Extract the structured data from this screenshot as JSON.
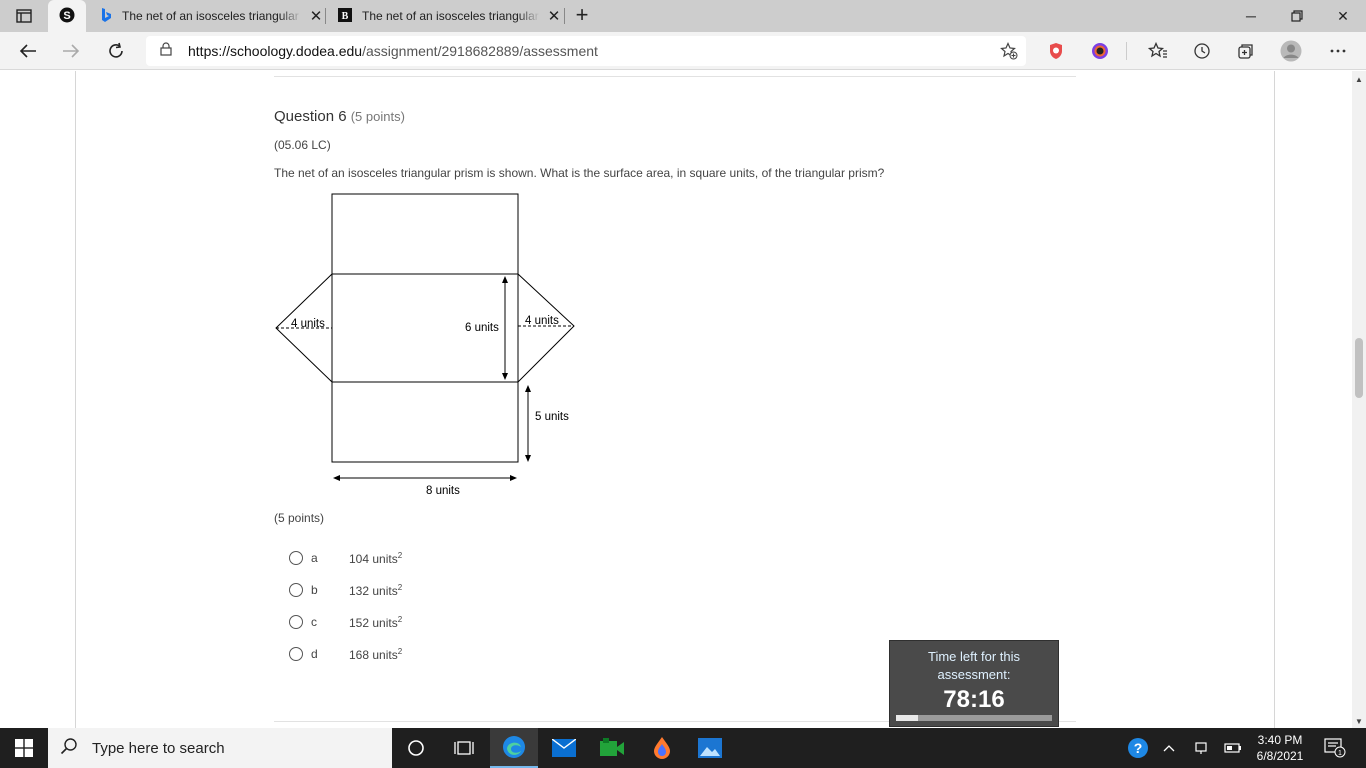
{
  "browser": {
    "tabs": [
      {
        "label": "S",
        "favicon": "schoology-icon"
      },
      {
        "label": "The net of an isosceles triangular",
        "favicon": "bing-icon"
      },
      {
        "label": "The net of an isosceles triangular",
        "favicon": "brainly-icon"
      }
    ],
    "url": {
      "host": "https://schoology.dodea.edu",
      "path": "/assignment/2918682889/assessment"
    }
  },
  "question": {
    "title": "Question 6",
    "points": "(5 points)",
    "code": "(05.06 LC)",
    "text": "The net of an isosceles triangular prism is shown. What is the surface area, in square units, of the triangular prism?",
    "points_footer": "(5 points)",
    "figure_labels": {
      "left_height": "4 units",
      "right_height": "4 units",
      "rect_height": "6 units",
      "side_height": "5 units",
      "width": "8 units"
    },
    "options": [
      {
        "letter": "a",
        "value": "104 units",
        "exp": "2"
      },
      {
        "letter": "b",
        "value": "132 units",
        "exp": "2"
      },
      {
        "letter": "c",
        "value": "152 units",
        "exp": "2"
      },
      {
        "letter": "d",
        "value": "168 units",
        "exp": "2"
      }
    ]
  },
  "timer": {
    "label": "Time left for this assessment:",
    "value": "78:16",
    "progress": 0.14
  },
  "taskbar": {
    "search_placeholder": "Type here to search",
    "time": "3:40 PM",
    "date": "6/8/2021",
    "notification_count": "1"
  }
}
